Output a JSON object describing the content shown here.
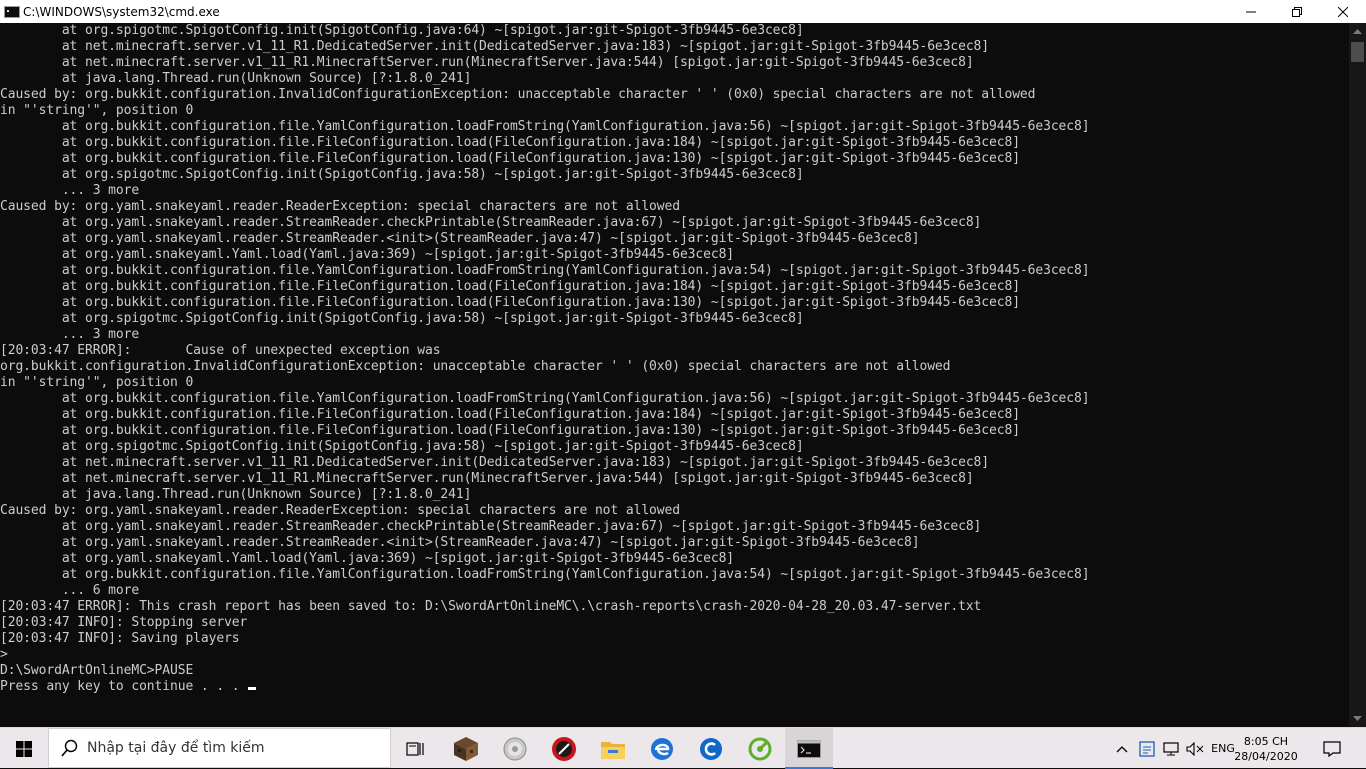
{
  "window": {
    "title": "C:\\WINDOWS\\system32\\cmd.exe",
    "icon": "cmd-icon",
    "controls": [
      "minimize-icon",
      "maximize-icon",
      "close-icon"
    ]
  },
  "console": {
    "lines": [
      "        at org.spigotmc.SpigotConfig.init(SpigotConfig.java:64) ~[spigot.jar:git-Spigot-3fb9445-6e3cec8]",
      "        at net.minecraft.server.v1_11_R1.DedicatedServer.init(DedicatedServer.java:183) ~[spigot.jar:git-Spigot-3fb9445-6e3cec8]",
      "        at net.minecraft.server.v1_11_R1.MinecraftServer.run(MinecraftServer.java:544) [spigot.jar:git-Spigot-3fb9445-6e3cec8]",
      "        at java.lang.Thread.run(Unknown Source) [?:1.8.0_241]",
      "Caused by: org.bukkit.configuration.InvalidConfigurationException: unacceptable character ' ' (0x0) special characters are not allowed",
      "in \"'string'\", position 0",
      "        at org.bukkit.configuration.file.YamlConfiguration.loadFromString(YamlConfiguration.java:56) ~[spigot.jar:git-Spigot-3fb9445-6e3cec8]",
      "        at org.bukkit.configuration.file.FileConfiguration.load(FileConfiguration.java:184) ~[spigot.jar:git-Spigot-3fb9445-6e3cec8]",
      "        at org.bukkit.configuration.file.FileConfiguration.load(FileConfiguration.java:130) ~[spigot.jar:git-Spigot-3fb9445-6e3cec8]",
      "        at org.spigotmc.SpigotConfig.init(SpigotConfig.java:58) ~[spigot.jar:git-Spigot-3fb9445-6e3cec8]",
      "        ... 3 more",
      "Caused by: org.yaml.snakeyaml.reader.ReaderException: special characters are not allowed",
      "        at org.yaml.snakeyaml.reader.StreamReader.checkPrintable(StreamReader.java:67) ~[spigot.jar:git-Spigot-3fb9445-6e3cec8]",
      "        at org.yaml.snakeyaml.reader.StreamReader.<init>(StreamReader.java:47) ~[spigot.jar:git-Spigot-3fb9445-6e3cec8]",
      "        at org.yaml.snakeyaml.Yaml.load(Yaml.java:369) ~[spigot.jar:git-Spigot-3fb9445-6e3cec8]",
      "        at org.bukkit.configuration.file.YamlConfiguration.loadFromString(YamlConfiguration.java:54) ~[spigot.jar:git-Spigot-3fb9445-6e3cec8]",
      "        at org.bukkit.configuration.file.FileConfiguration.load(FileConfiguration.java:184) ~[spigot.jar:git-Spigot-3fb9445-6e3cec8]",
      "        at org.bukkit.configuration.file.FileConfiguration.load(FileConfiguration.java:130) ~[spigot.jar:git-Spigot-3fb9445-6e3cec8]",
      "        at org.spigotmc.SpigotConfig.init(SpigotConfig.java:58) ~[spigot.jar:git-Spigot-3fb9445-6e3cec8]",
      "        ... 3 more",
      "[20:03:47 ERROR]:       Cause of unexpected exception was",
      "org.bukkit.configuration.InvalidConfigurationException: unacceptable character ' ' (0x0) special characters are not allowed",
      "in \"'string'\", position 0",
      "        at org.bukkit.configuration.file.YamlConfiguration.loadFromString(YamlConfiguration.java:56) ~[spigot.jar:git-Spigot-3fb9445-6e3cec8]",
      "        at org.bukkit.configuration.file.FileConfiguration.load(FileConfiguration.java:184) ~[spigot.jar:git-Spigot-3fb9445-6e3cec8]",
      "        at org.bukkit.configuration.file.FileConfiguration.load(FileConfiguration.java:130) ~[spigot.jar:git-Spigot-3fb9445-6e3cec8]",
      "        at org.spigotmc.SpigotConfig.init(SpigotConfig.java:58) ~[spigot.jar:git-Spigot-3fb9445-6e3cec8]",
      "        at net.minecraft.server.v1_11_R1.DedicatedServer.init(DedicatedServer.java:183) ~[spigot.jar:git-Spigot-3fb9445-6e3cec8]",
      "        at net.minecraft.server.v1_11_R1.MinecraftServer.run(MinecraftServer.java:544) [spigot.jar:git-Spigot-3fb9445-6e3cec8]",
      "        at java.lang.Thread.run(Unknown Source) [?:1.8.0_241]",
      "Caused by: org.yaml.snakeyaml.reader.ReaderException: special characters are not allowed",
      "        at org.yaml.snakeyaml.reader.StreamReader.checkPrintable(StreamReader.java:67) ~[spigot.jar:git-Spigot-3fb9445-6e3cec8]",
      "        at org.yaml.snakeyaml.reader.StreamReader.<init>(StreamReader.java:47) ~[spigot.jar:git-Spigot-3fb9445-6e3cec8]",
      "        at org.yaml.snakeyaml.Yaml.load(Yaml.java:369) ~[spigot.jar:git-Spigot-3fb9445-6e3cec8]",
      "        at org.bukkit.configuration.file.YamlConfiguration.loadFromString(YamlConfiguration.java:54) ~[spigot.jar:git-Spigot-3fb9445-6e3cec8]",
      "        ... 6 more",
      "[20:03:47 ERROR]: This crash report has been saved to: D:\\SwordArtOnlineMC\\.\\crash-reports\\crash-2020-04-28_20.03.47-server.txt",
      "[20:03:47 INFO]: Stopping server",
      "[20:03:47 INFO]: Saving players",
      ">",
      "D:\\SwordArtOnlineMC>PAUSE",
      "Press any key to continue . . ."
    ]
  },
  "taskbar": {
    "start_icon": "windows-logo-icon",
    "search_placeholder": "Nhập tại đây để tìm kiếm",
    "apps": [
      {
        "name": "task-view-icon"
      },
      {
        "name": "minecraft-icon"
      },
      {
        "name": "disc-icon"
      },
      {
        "name": "red-circle-app-icon"
      },
      {
        "name": "file-explorer-icon"
      },
      {
        "name": "edge-icon"
      },
      {
        "name": "ccleaner-icon"
      },
      {
        "name": "green-leaf-app-icon"
      },
      {
        "name": "cmd-icon"
      }
    ],
    "tray": {
      "language": "ENG",
      "time": "8:05 CH",
      "date": "28/04/2020"
    }
  }
}
